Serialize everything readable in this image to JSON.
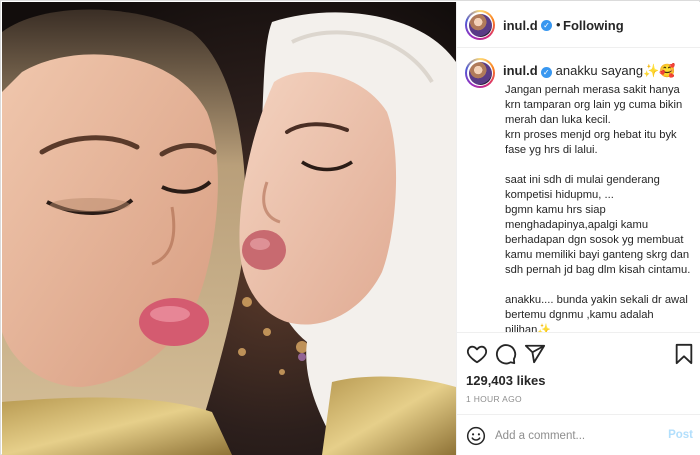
{
  "post": {
    "username": "inul.d",
    "follow_label": "Following",
    "dot": "•",
    "verified_mark": "✓",
    "caption_title": "anakku sayang✨🥰",
    "caption_body": "Jangan pernah merasa sakit hanya krn tamparan org lain yg cuma bikin merah dan luka kecil.\nkrn proses menjd org hebat itu byk fase yg hrs di lalui.\n\nsaat ini sdh di mulai genderang kompetisi hidupmu, ...\nbgmn kamu hrs siap menghadapinya,apalgi kamu berhadapan dgn sosok yg membuat kamu memiliki bayi ganteng skrg dan sdh pernah jd bag dlm kisah cintamu.\n\nanakku.... bunda yakin sekali dr awal bertemu dgnmu ,kamu adalah pilihan✨\nhadapi rasa sakit itu",
    "likes": "129,403 likes",
    "time": "1 HOUR AGO",
    "comment_placeholder": "Add a comment...",
    "post_label": "Post"
  },
  "icons": {
    "like": "heart-icon",
    "comment": "comment-icon",
    "share": "share-icon",
    "save": "bookmark-icon",
    "emoji": "emoji-icon",
    "verified": "verified-badge-icon"
  },
  "colors": {
    "verified": "#3897f0",
    "post_disabled": "#b2dffc",
    "secondary_text": "#8e8e8e",
    "text": "#262626",
    "border": "#efefef"
  }
}
